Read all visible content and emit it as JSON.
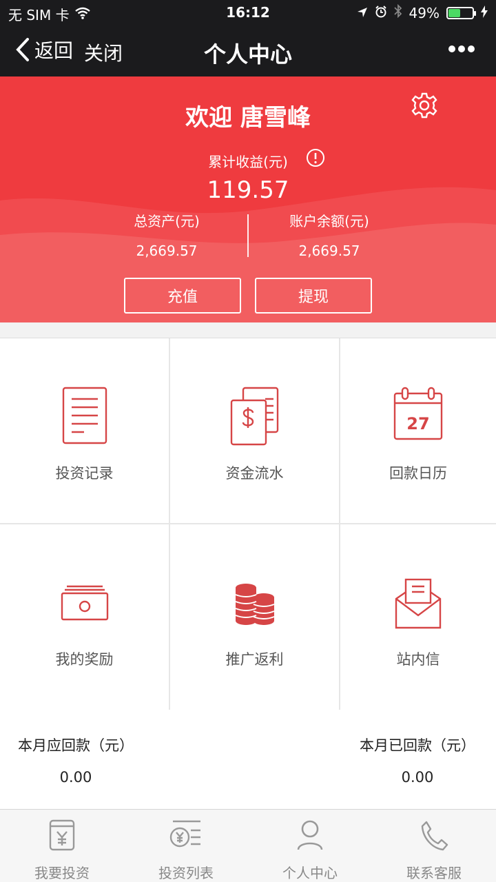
{
  "status_bar": {
    "carrier": "无 SIM 卡",
    "time": "16:12",
    "battery": "49%",
    "battery_level": 0.49
  },
  "nav": {
    "back_label": "返回",
    "close_label": "关闭",
    "title": "个人中心"
  },
  "hero": {
    "welcome": "欢迎 唐雪峰",
    "earnings_label": "累计收益(元)",
    "earnings_value": "119.57",
    "total_assets_label": "总资产(元)",
    "total_assets_value": "2,669.57",
    "balance_label": "账户余额(元)",
    "balance_value": "2,669.57",
    "recharge_label": "充值",
    "withdraw_label": "提现",
    "accent": "#ef3b3f"
  },
  "grid": [
    {
      "label": "投资记录",
      "icon": "document-list-icon"
    },
    {
      "label": "资金流水",
      "icon": "money-bill-icon"
    },
    {
      "label": "回款日历",
      "icon": "calendar-icon",
      "calendar_day": "27"
    },
    {
      "label": "我的奖励",
      "icon": "cash-icon"
    },
    {
      "label": "推广返利",
      "icon": "coins-icon"
    },
    {
      "label": "站内信",
      "icon": "mail-icon"
    }
  ],
  "returns": {
    "due_label": "本月应回款（元）",
    "due_value": "0.00",
    "received_label": "本月已回款（元）",
    "received_value": "0.00"
  },
  "tabbar": [
    {
      "label": "我要投资",
      "icon": "invest-icon"
    },
    {
      "label": "投资列表",
      "icon": "invest-list-icon"
    },
    {
      "label": "个人中心",
      "icon": "user-icon"
    },
    {
      "label": "联系客服",
      "icon": "phone-icon"
    }
  ]
}
